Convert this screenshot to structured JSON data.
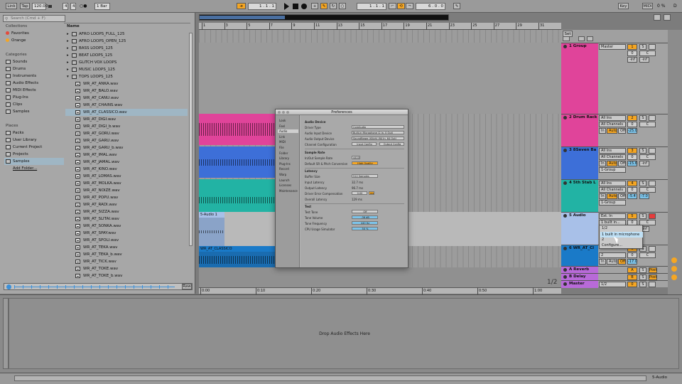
{
  "transport": {
    "link": "Link",
    "tap": "Tap",
    "tempo": "120.00",
    "sig_num": "4",
    "sig_den": "4",
    "metro": "○●",
    "quant": "1 Bar",
    "pos1": "1 .",
    "pos2": "1 .",
    "pos3": "1",
    "loop1": "1 .",
    "loop2": "1 .",
    "loop3": "1",
    "len1": "6 .",
    "len2": "0 .",
    "len3": "0",
    "key": "Key",
    "midi": "MIDI",
    "cpu": "0 %",
    "d": "D"
  },
  "browser": {
    "search_placeholder": "Search (Cmd + F)",
    "collections_label": "Collections",
    "collections": [
      {
        "label": "Favorites",
        "color": "#e44a3c"
      },
      {
        "label": "Orange",
        "color": "#f5a623"
      }
    ],
    "categories_label": "Categories",
    "categories": [
      "Sounds",
      "Drums",
      "Instruments",
      "Audio Effects",
      "MIDI Effects",
      "Plug-Ins",
      "Clips",
      "Samples"
    ],
    "places_label": "Places",
    "places": [
      "Packs",
      "User Library",
      "Current Project",
      "Projects",
      "Samples",
      "Add Folder..."
    ],
    "column_name": "Name",
    "folders": [
      "AFRO LOOPS_FULL_125",
      "AFRO LOOPS_OPEN_125",
      "BASS LOOPS_125",
      "BEAT LOOPS_125",
      "GLITCH VOX LOOPS",
      "MUSIC LOOPS_125",
      "TOPS LOOPS_125"
    ],
    "files": [
      "WR_AT_ANKA.wav",
      "WR_AT_BALO.wav",
      "WR_AT_CANU.wav",
      "WR_AT_CHAINS.wav",
      "WR_AT_CLASSICO.wav",
      "WR_AT_DIGI.wav",
      "WR_AT_DIGI_b.wav",
      "WR_AT_GORU.wav",
      "WR_AT_GARU.wav",
      "WR_AT_GARU_b.wav",
      "WR_AT_IMAL.wav",
      "WR_AT_JAMAL.wav",
      "WR_AT_KINO.wav",
      "WR_AT_LOMAS.wav",
      "WR_AT_MOLKA.wav",
      "WR_AT_NOIZE.wav",
      "WR_AT_POPU.wav",
      "WR_AT_RADI.wav",
      "WR_AT_SIZZA.wav",
      "WR_AT_SLITAI.wav",
      "WR_AT_SONKA.wav",
      "WR_AT_SPAY.wav",
      "WR_AT_SPOLI.wav",
      "WR_AT_TEKA.wav",
      "WR_AT_TEKA_b.wav",
      "WR_AT_TICK.wav",
      "WR_AT_TOKE.wav",
      "WR_AT_TOKE_b.wav"
    ],
    "preview_label": "Raw"
  },
  "arrangement": {
    "ruler": [
      "1",
      "3",
      "5",
      "7",
      "9",
      "11",
      "13",
      "15",
      "17",
      "19",
      "21",
      "23",
      "25",
      "27",
      "29",
      "31"
    ],
    "time_labels": [
      "0:00",
      "0:10",
      "0:20",
      "0:30",
      "0:40",
      "0:50",
      "1:00"
    ],
    "clip_audio": "5-Audio 1",
    "clip_classico": "WR_AT_CLASSICO",
    "page": "1/2"
  },
  "mixer": {
    "set_label": "Set",
    "master_label": "Master",
    "tracks": [
      {
        "name": "1 Group",
        "color": "#e0449a",
        "num": "1"
      },
      {
        "name": "2 Drum Rack",
        "color": "#e0449a",
        "num": "2",
        "in": "All Ins",
        "ch": "All Channels",
        "vol": "-25.0"
      },
      {
        "name": "3 8Seven Ba",
        "color": "#3d6fd8",
        "num": "3",
        "in": "All Ins",
        "ch": "All Channels",
        "vol": "-15.6",
        "inf": "-inf",
        "grp": "1-Group"
      },
      {
        "name": "4 5th Stab L",
        "color": "#22b3a4",
        "num": "4",
        "in": "All Ins",
        "ch": "All Channels",
        "vol": "-5.4",
        "vol2": "-7.0",
        "pan": "-1.6",
        "grp": "1-Group"
      },
      {
        "name": "5 Audio",
        "color": "#a8c0e8",
        "num": "5",
        "in": "Ext. In",
        "ch": "1 built in...",
        "opt1": "1/2",
        "opt2": "1 built in microphone",
        "opt3": "2",
        "opt4": "Configure..."
      },
      {
        "name": "6 WR_AT_Cl",
        "color": "#1a7ac8",
        "num": "6",
        "vol": "-17.0",
        "pan": "-6.0",
        "ch": "2"
      },
      {
        "name": "A Reverb",
        "color": "#b86ad8",
        "num": "A",
        "post": "Post"
      },
      {
        "name": "B Delay",
        "color": "#b86ad8",
        "num": "B",
        "post": "Post"
      },
      {
        "name": "Master",
        "color": "#b86ad8",
        "num": "0",
        "io": "1/2"
      }
    ],
    "in_label": "In",
    "auto_label": "Auto",
    "off_label": "Off",
    "s_label": "S",
    "c_label": "C",
    "inf_label": "-inf",
    "zero_label": "0"
  },
  "prefs": {
    "title": "Preferences",
    "tabs": [
      "Look",
      "Feel",
      "Audio",
      "Link",
      "MIDI",
      "File",
      "Folder",
      "Library",
      "Plug-Ins",
      "Record",
      "Warp",
      "Launch",
      "Licenses",
      "Maintenance"
    ],
    "section_device": "Audio Device",
    "driver_type": "Driver Type",
    "driver_val": "CoreAudio",
    "input_dev": "Audio Input Device",
    "input_val": "Built-in Microphone (2 In, 0 Out)",
    "output_dev": "Audio Output Device",
    "output_val": "Soundflower (64ch) (64 In, 64 Out)",
    "chan_cfg": "Channel Configuration",
    "input_cfg": "Input Config",
    "output_cfg": "Output Config",
    "section_rate": "Sample Rate",
    "in_out_rate": "In/Out Sample Rate",
    "rate_val": "44100",
    "default_sr": "Default SR & Pitch Conversion",
    "hq": "High Quality",
    "section_latency": "Latency",
    "buffer": "Buffer Size",
    "buffer_val": "512 Samples",
    "in_lat": "Input Latency",
    "in_lat_val": "32.7 ms",
    "out_lat": "Output Latency",
    "out_lat_val": "96.7 ms",
    "drv_err": "Driver Error Compensation",
    "drv_err_val": "0.00",
    "ms": "ms",
    "overall": "Overall Latency",
    "overall_val": "129 ms",
    "section_test": "Test",
    "test_tone": "Test Tone",
    "off": "Off",
    "tone_vol": "Tone Volume",
    "tone_vol_val": "-36 dB",
    "tone_freq": "Tone Frequency",
    "tone_freq_val": "440 Hz",
    "cpu_sim": "CPU Usage Simulator",
    "cpu_sim_val": "50 %"
  },
  "detail": {
    "drop_text": "Drop Audio Effects Here",
    "status_right": "5-Audio"
  }
}
